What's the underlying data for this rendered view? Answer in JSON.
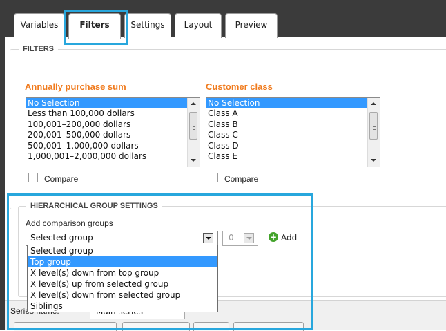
{
  "tabs": [
    {
      "label": "Variables"
    },
    {
      "label": "Filters"
    },
    {
      "label": "Settings"
    },
    {
      "label": "Layout"
    },
    {
      "label": "Preview"
    }
  ],
  "filters": {
    "legend": "FILTERS",
    "annual": {
      "label": "Annually purchase sum",
      "options": [
        "No Selection",
        "Less than 100,000 dollars",
        "100,001–200,000 dollars",
        "200,001–500,000 dollars",
        "500,001–1,000,000 dollars",
        "1,000,001–2,000,000 dollars"
      ],
      "selected": "No Selection",
      "compare_label": "Compare"
    },
    "customer": {
      "label": "Customer class",
      "options": [
        "No Selection",
        "Class A",
        "Class B",
        "Class C",
        "Class D",
        "Class E"
      ],
      "selected": "No Selection",
      "compare_label": "Compare"
    }
  },
  "hier": {
    "legend": "HIERARCHICAL GROUP SETTINGS",
    "add_label": "Add comparison groups",
    "select_value": "Selected group",
    "level_value": "0",
    "add_button": "Add",
    "dropdown_options": [
      "Selected group",
      "Top group",
      "X level(s) down from top group",
      "X level(s) up from selected group",
      "X level(s) down from selected group",
      "Siblings"
    ],
    "dropdown_selected": "Top group"
  },
  "series": {
    "label": "Series name:",
    "value": "Main series"
  },
  "colors": {
    "accent": "#28a7dd",
    "label_orange": "#f07b1e",
    "selection": "#3399ff",
    "add_green": "#43a32b",
    "dark_bg": "#3b3b3b"
  },
  "icons": [
    "scroll-up-icon",
    "scroll-down-icon",
    "dropdown-arrow-icon",
    "add-plus-icon"
  ]
}
